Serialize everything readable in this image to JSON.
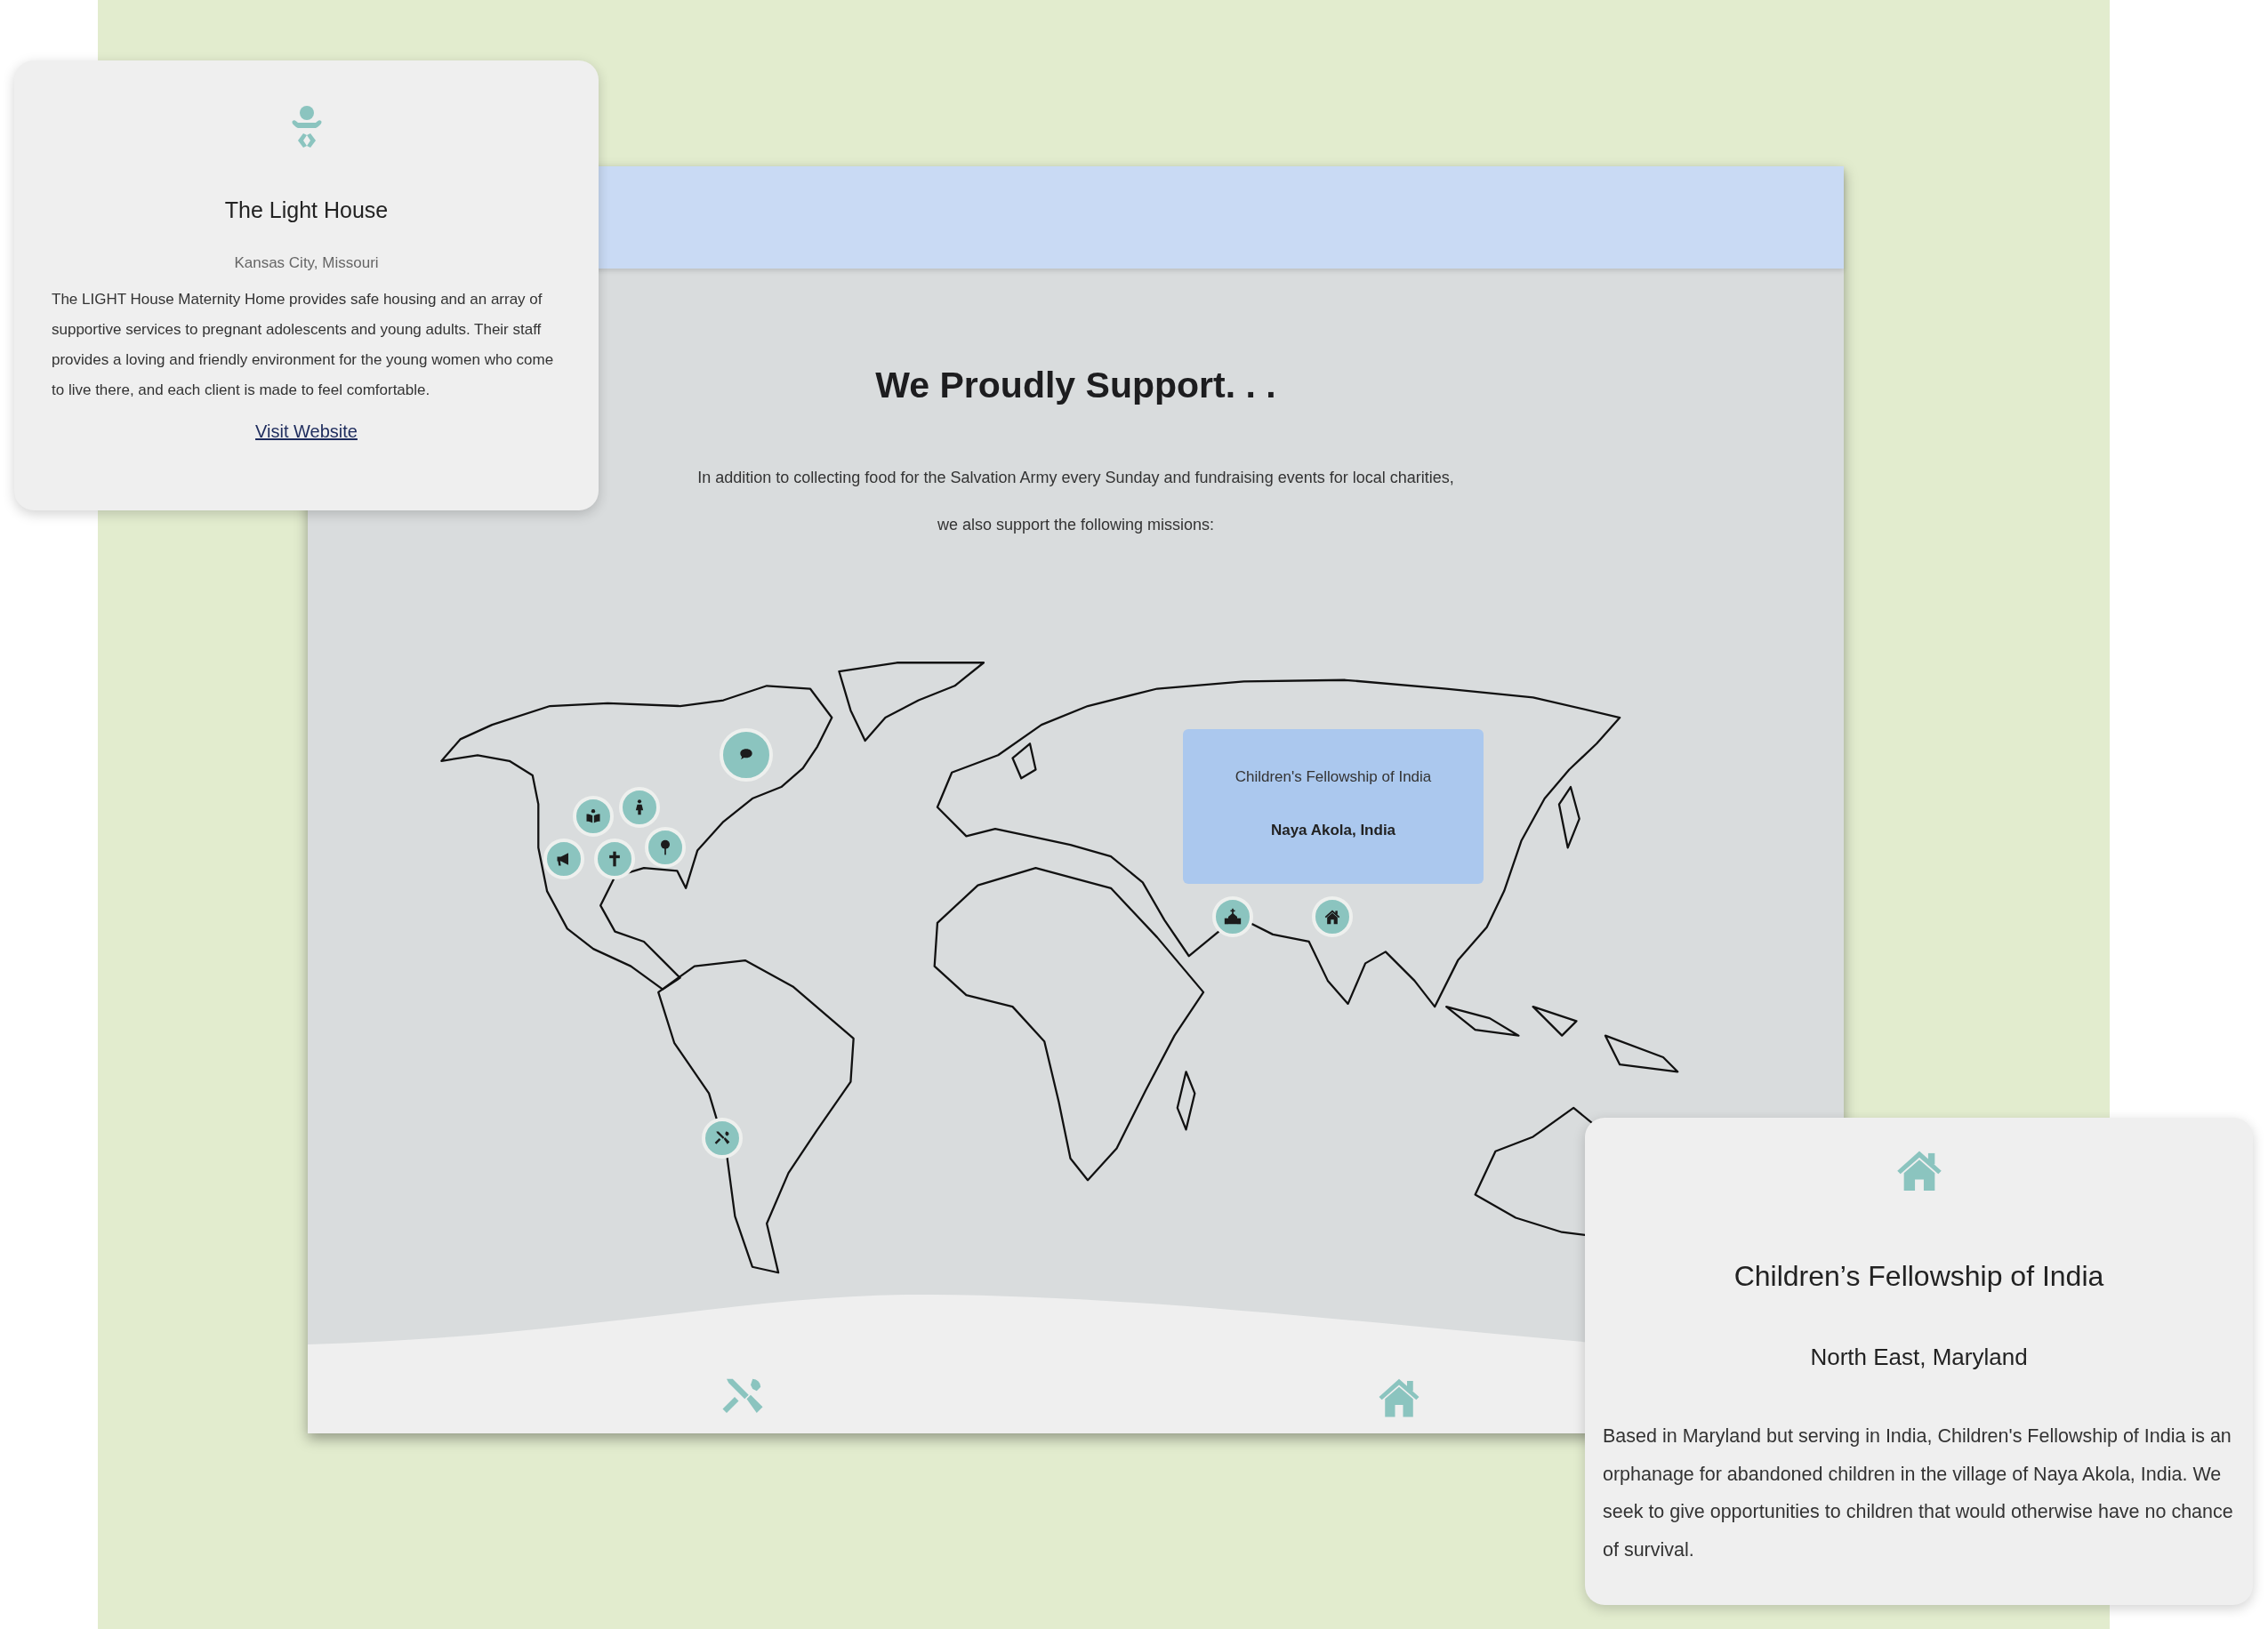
{
  "section": {
    "heading": "We Proudly Support. . .",
    "intro_lines": [
      "In addition to collecting food for the Salvation Army every Sunday and fundraising events for local charities,",
      "we also support the following missions:"
    ]
  },
  "map": {
    "tooltip": {
      "title": "Children's Fellowship of India",
      "location": "Naya Akola, India"
    }
  },
  "left_card": {
    "title": "The Light House",
    "location": "Kansas City, Missouri",
    "description": "The LIGHT House Maternity Home provides safe housing and an array of supportive services to pregnant adolescents and young adults. Their staff provides a loving and friendly environment for the young women who come to live there, and each client is made to feel comfortable.",
    "link": "Visit Website"
  },
  "right_card": {
    "title": "Children’s Fellowship of India",
    "location": "North East, Maryland",
    "description": "Based in Maryland but serving in India, Children's Fellowship of India is an orphanage for abandoned children in the village of Naya Akola, India. We seek to give opportunities to children that would otherwise have no chance of survival."
  }
}
